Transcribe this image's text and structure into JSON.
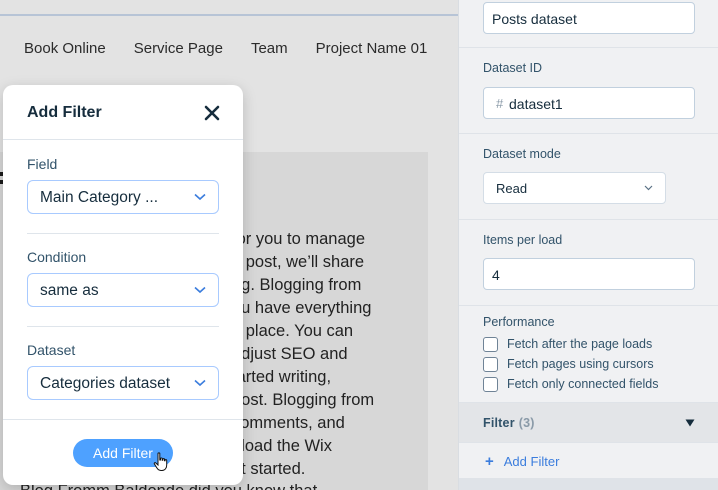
{
  "site_nav": [
    "Book Online",
    "Service Page",
    "Team",
    "Project Name 01"
  ],
  "page_content": {
    "heading_fragment": "e",
    "body_lines": [
      "for you to manage",
      "g post, we’ll share",
      "og. Blogging from",
      "ou have everything",
      "e place. You can",
      "adjust SEO and",
      "tarted writing,",
      "post. Blogging from",
      "comments, and",
      "nload the Wix",
      "et started."
    ],
    "bottom_fragment": "Blog Fromm Baldonde did you know that"
  },
  "modal": {
    "title": "Add Filter",
    "close_icon": "close-icon",
    "field_label": "Field",
    "field_value": "Main Category ...",
    "condition_label": "Condition",
    "condition_value": "same as",
    "dataset_label": "Dataset",
    "dataset_value": "Categories dataset",
    "button_label": "Add Filter"
  },
  "panel": {
    "dataset_name_value": "Posts dataset",
    "dataset_id_label": "Dataset ID",
    "dataset_id_prefix": "#",
    "dataset_id_value": "dataset1",
    "dataset_mode_label": "Dataset mode",
    "dataset_mode_value": "Read",
    "items_per_load_label": "Items per load",
    "items_per_load_value": "4",
    "performance_label": "Performance",
    "performance_options": [
      {
        "label": "Fetch after the page loads",
        "checked": false
      },
      {
        "label": "Fetch pages using cursors",
        "checked": false
      },
      {
        "label": "Fetch only connected fields",
        "checked": false
      }
    ],
    "filter_title": "Filter",
    "filter_count": "(3)",
    "add_filter_plus": "+",
    "add_filter_label": "Add Filter"
  },
  "colors": {
    "accent": "#4ea1ff",
    "link": "#3b7ddd",
    "text_primary": "#162d3d",
    "text_secondary": "#32536a"
  }
}
